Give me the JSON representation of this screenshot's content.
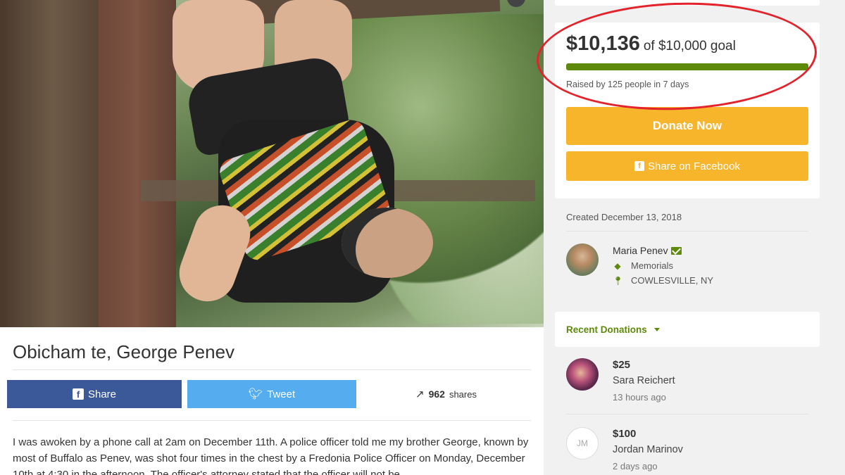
{
  "campaign": {
    "title": "Obicham te, George Penev",
    "story": "I was awoken by a phone call at 2am on December 11th. A police officer told me my brother George, known by most of Buffalo as Penev, was shot four times in the chest by a Fredonia Police Officer on Monday, December 10th at 4:30 in the afternoon. The officer's attorney stated that the officer will not be"
  },
  "share_bar": {
    "facebook_label": "Share",
    "tweet_label": "Tweet",
    "shares_count": "962",
    "shares_label": "shares"
  },
  "donation_box": {
    "raised_amount": "$10,136",
    "goal_text": "of $10,000 goal",
    "progress_percent": 100,
    "raised_by_text": "Raised by 125 people in 7 days",
    "donate_button": "Donate Now",
    "share_facebook_button": "Share on Facebook"
  },
  "details": {
    "created": "Created December 13, 2018",
    "organizer_name": "Maria Penev",
    "category": "Memorials",
    "location": "COWLESVILLE, NY"
  },
  "recent_donations": {
    "header": "Recent Donations",
    "items": [
      {
        "amount": "$25",
        "name": "Sara Reichert",
        "time": "13 hours ago",
        "initials": ""
      },
      {
        "amount": "$100",
        "name": "Jordan Marinov",
        "time": "2 days ago",
        "initials": "JM"
      }
    ]
  },
  "colors": {
    "accent_green": "#5d8a0b",
    "donate_orange": "#f7b52b",
    "facebook_blue": "#3b5998",
    "twitter_blue": "#55acee",
    "annotation_red": "#e3232b"
  },
  "icons": {
    "facebook": "facebook-icon",
    "twitter": "twitter-bird-icon",
    "trend": "trending-up-icon",
    "verified": "envelope-check-icon",
    "tag": "tag-icon",
    "location": "map-pin-icon",
    "caret": "caret-down-icon"
  }
}
